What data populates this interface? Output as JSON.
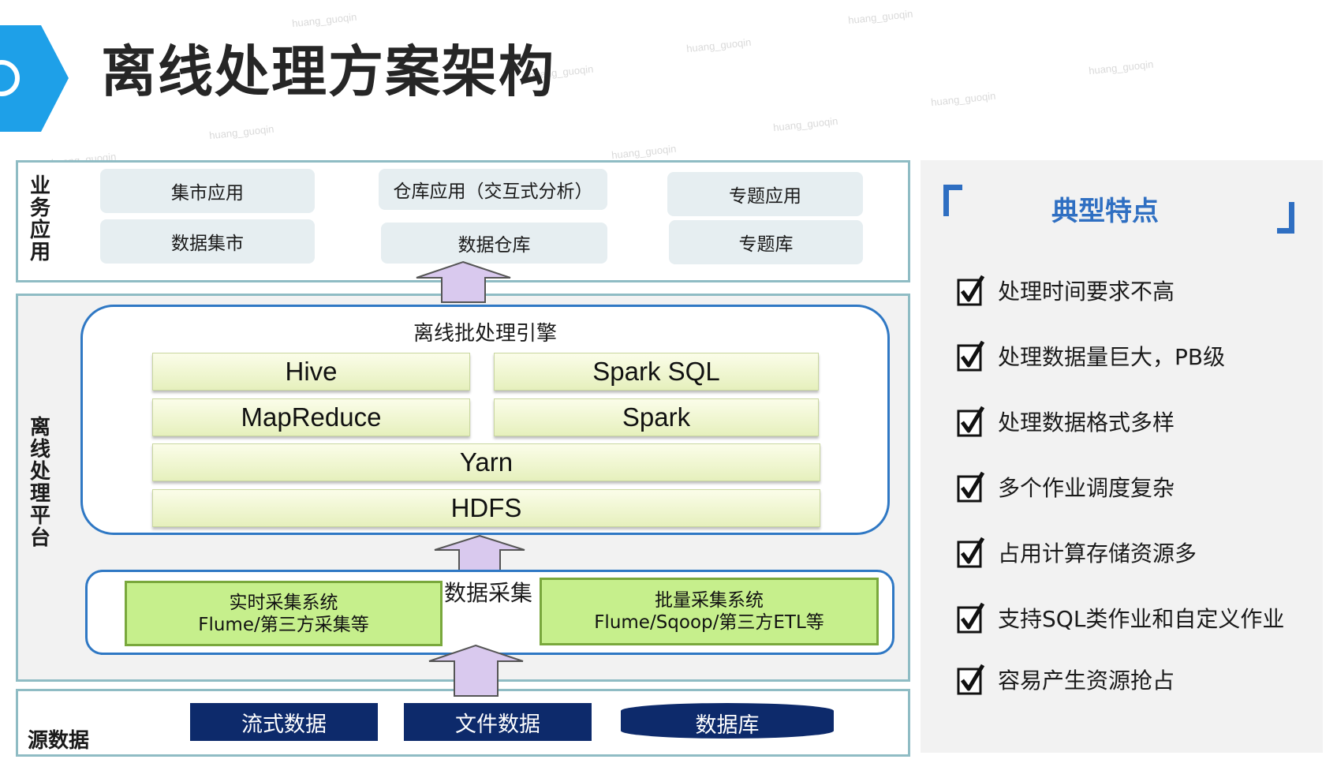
{
  "title": "离线处理方案架构",
  "sections": {
    "business": {
      "label": "业务应用",
      "apps": [
        "集市应用",
        "仓库应用（交互式分析）",
        "专题应用"
      ],
      "stores": [
        "数据集市",
        "数据仓库",
        "专题库"
      ]
    },
    "platform": {
      "label": "离线处理平台",
      "engine_title": "离线批处理引擎",
      "components": [
        "Hive",
        "Spark SQL",
        "MapReduce",
        "Spark",
        "Yarn",
        "HDFS"
      ],
      "collection": {
        "title": "数据采集",
        "realtime": {
          "line1": "实时采集系统",
          "line2": "Flume/第三方采集等"
        },
        "batch": {
          "line1": "批量采集系统",
          "line2": "Flume/Sqoop/第三方ETL等"
        }
      }
    },
    "source": {
      "label": "源数据",
      "items": [
        "流式数据",
        "文件数据",
        "数据库"
      ]
    }
  },
  "features": {
    "title": "典型特点",
    "items": [
      "处理时间要求不高",
      "处理数据量巨大，PB级",
      "处理数据格式多样",
      "多个作业调度复杂",
      "占用计算存储资源多",
      "支持SQL类作业和自定义作业",
      "容易产生资源抢占"
    ]
  },
  "watermark": "huang_guoqin",
  "colors": {
    "section_border": "#8fbcc4",
    "engine_border": "#2f78c4",
    "component_fill": "#eef5cf",
    "collect_fill": "#c6ef8c",
    "source_fill": "#0d2a6b",
    "feature_title": "#2f6fc2",
    "arrow_fill": "#d9c9ee"
  }
}
